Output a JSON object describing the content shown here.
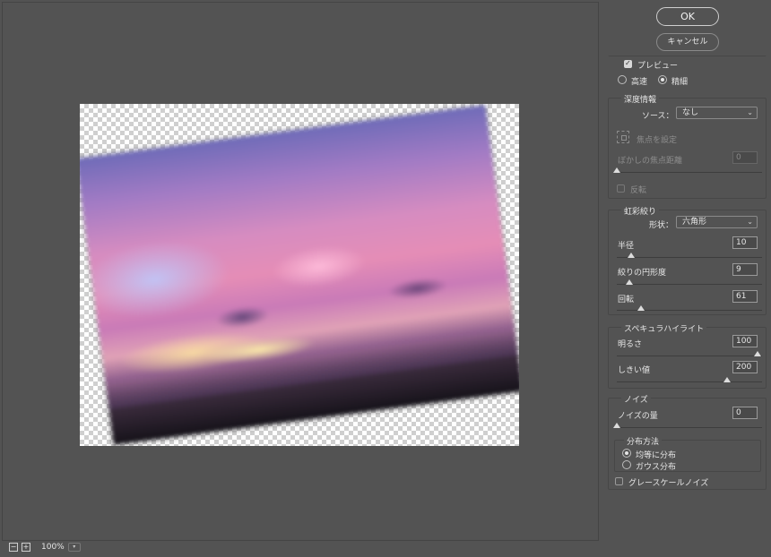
{
  "buttons": {
    "ok": "OK",
    "cancel": "キャンセル"
  },
  "preview": {
    "label": "プレビュー",
    "checked": true
  },
  "quality": {
    "fast": "高速",
    "fine": "精細",
    "selected": "精細"
  },
  "depth": {
    "title": "深度情報",
    "source_label": "ソース：",
    "source_value": "なし",
    "set_focus": "焦点を設定",
    "blur_focal_distance": "ぼかしの焦点距離",
    "blur_focal_value": "0",
    "invert": "反転"
  },
  "iris": {
    "title": "虹彩絞り",
    "shape_label": "形状：",
    "shape_value": "六角形",
    "radius_label": "半径",
    "radius_value": "10",
    "roundness_label": "絞りの円形度",
    "roundness_value": "9",
    "rotation_label": "回転",
    "rotation_value": "61"
  },
  "specular": {
    "title": "スペキュラハイライト",
    "brightness_label": "明るさ",
    "brightness_value": "100",
    "threshold_label": "しきい値",
    "threshold_value": "200"
  },
  "noise": {
    "title": "ノイズ",
    "amount_label": "ノイズの量",
    "amount_value": "0",
    "distribution_title": "分布方法",
    "uniform": "均等に分布",
    "gaussian": "ガウス分布",
    "selected": "均等に分布",
    "grayscale": "グレースケールノイズ"
  },
  "status": {
    "zoom": "100%"
  }
}
